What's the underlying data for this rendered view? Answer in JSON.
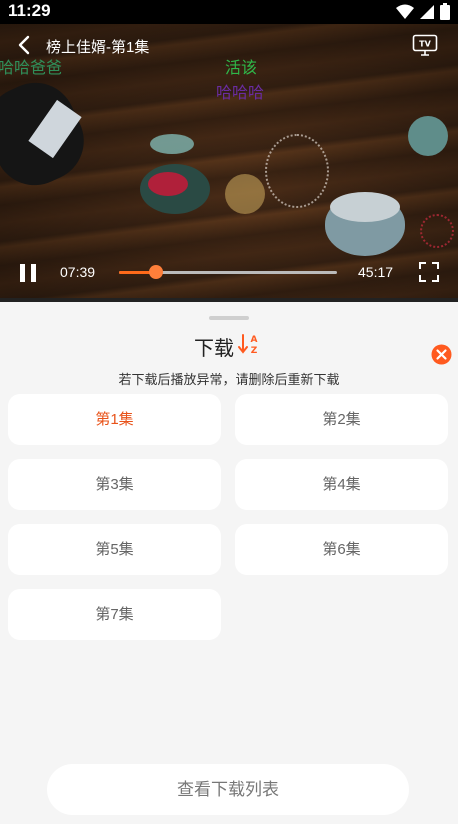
{
  "status_bar": {
    "time": "11:29"
  },
  "player": {
    "title": "榜上佳婿-第1集",
    "current_time": "07:39",
    "total_time": "45:17",
    "progress": 0.169,
    "danmu": [
      {
        "text": "哈哈爸爸",
        "color": "#2f8f5a"
      },
      {
        "text": "活该",
        "color": "#2fb84a"
      },
      {
        "text": "哈哈哈",
        "color": "#6a2ca0"
      }
    ]
  },
  "sheet": {
    "title": "下载",
    "hint": "若下载后播放异常，请删除后重新下载",
    "episodes": [
      "第1集",
      "第2集",
      "第3集",
      "第4集",
      "第5集",
      "第6集",
      "第7集"
    ],
    "active_episode": "第1集",
    "view_list_label": "查看下载列表",
    "accent_color": "#ff5a1f"
  }
}
